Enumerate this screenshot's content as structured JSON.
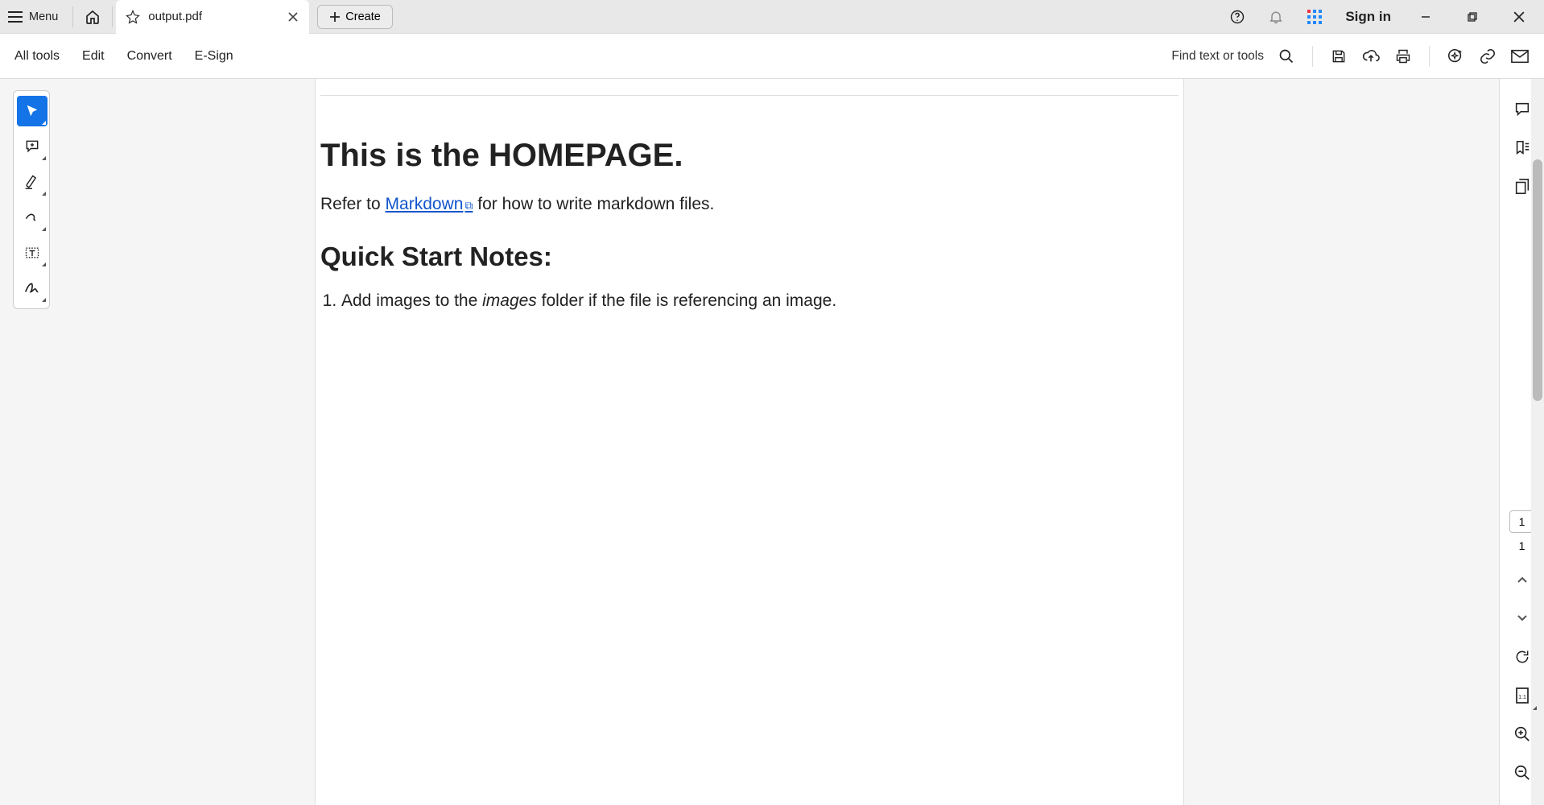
{
  "titlebar": {
    "menu_label": "Menu",
    "tab_name": "output.pdf",
    "create_label": "Create",
    "signin_label": "Sign in"
  },
  "toolbar": {
    "all_tools": "All tools",
    "edit": "Edit",
    "convert": "Convert",
    "esign": "E-Sign",
    "find_label": "Find text or tools"
  },
  "document": {
    "h1_prefix": "This is the ",
    "h1_bold": "HOMEPAGE",
    "h1_suffix": ".",
    "p_refer_prefix": "Refer to ",
    "p_link_text": "Markdown",
    "p_refer_suffix": " for how to write markdown files.",
    "h2": "Quick Start Notes:",
    "li1_prefix": "Add images to the ",
    "li1_italic": "images",
    "li1_suffix": " folder if the file is referencing an image."
  },
  "pagenav": {
    "current": "1",
    "total": "1"
  }
}
